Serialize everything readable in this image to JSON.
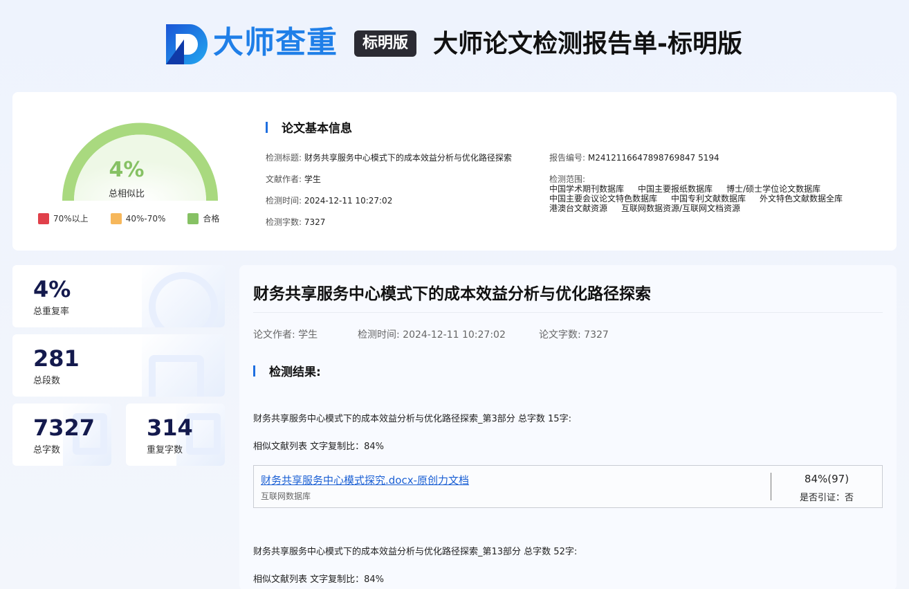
{
  "header": {
    "logo_text": "大师查重",
    "edition_badge": "标明版",
    "report_title": "大师论文检测报告单-标明版"
  },
  "summary": {
    "similarity_percent": "4%",
    "similarity_label": "总相似比",
    "similarity_fraction": 0.04,
    "legend": [
      {
        "label": "70%以上",
        "color": "#e0404a"
      },
      {
        "label": "40%-70%",
        "color": "#f6b75b"
      },
      {
        "label": "合格",
        "color": "#86c164"
      }
    ]
  },
  "basic_info": {
    "heading": "论文基本信息",
    "title_label": "检测标题:",
    "title_value": "财务共享服务中心模式下的成本效益分析与优化路径探索",
    "author_label": "文献作者:",
    "author_value": "学生",
    "time_label": "检测时间:",
    "time_value": "2024-12-11 10:27:02",
    "words_label": "检测字数:",
    "words_value": "7327",
    "report_no_label": "报告编号:",
    "report_no_value": "M2412116647898769847 5194",
    "scope_label": "检测范围:",
    "scope": [
      "中国学术期刊数据库",
      "中国主要报纸数据库",
      "博士/硕士学位论文数据库",
      "中国主要会议论文特色数据库",
      "中国专利文献数据库",
      "外文特色文献数据全库",
      "港澳台文献资源",
      "互联网数据资源/互联网文档资源"
    ]
  },
  "stats": {
    "total_rate": {
      "value": "4%",
      "label": "总重复率"
    },
    "paragraphs": {
      "value": "281",
      "label": "总段数"
    },
    "total_words": {
      "value": "7327",
      "label": "总字数"
    },
    "dup_words": {
      "value": "314",
      "label": "重复字数"
    }
  },
  "main": {
    "paper_title": "财务共享服务中心模式下的成本效益分析与优化路径探索",
    "meta_author": "论文作者: 学生",
    "meta_time": "检测时间: 2024-12-11 10:27:02",
    "meta_words": "论文字数: 7327",
    "result_heading": "检测结果:",
    "parts": [
      {
        "part_line": "财务共享服务中心模式下的成本效益分析与优化路径探索_第3部分 总字数 15字:",
        "sim_line": "相似文献列表 文字复制比：84%",
        "source_title": "财务共享服务中心模式探究.docx-原创力文档",
        "source_db": "互联网数据库",
        "source_pct": "84%(97)",
        "cited": "是否引证：否"
      },
      {
        "part_line": "财务共享服务中心模式下的成本效益分析与优化路径探索_第13部分 总字数 52字:",
        "sim_line": "相似文献列表 文字复制比：84%"
      }
    ]
  }
}
